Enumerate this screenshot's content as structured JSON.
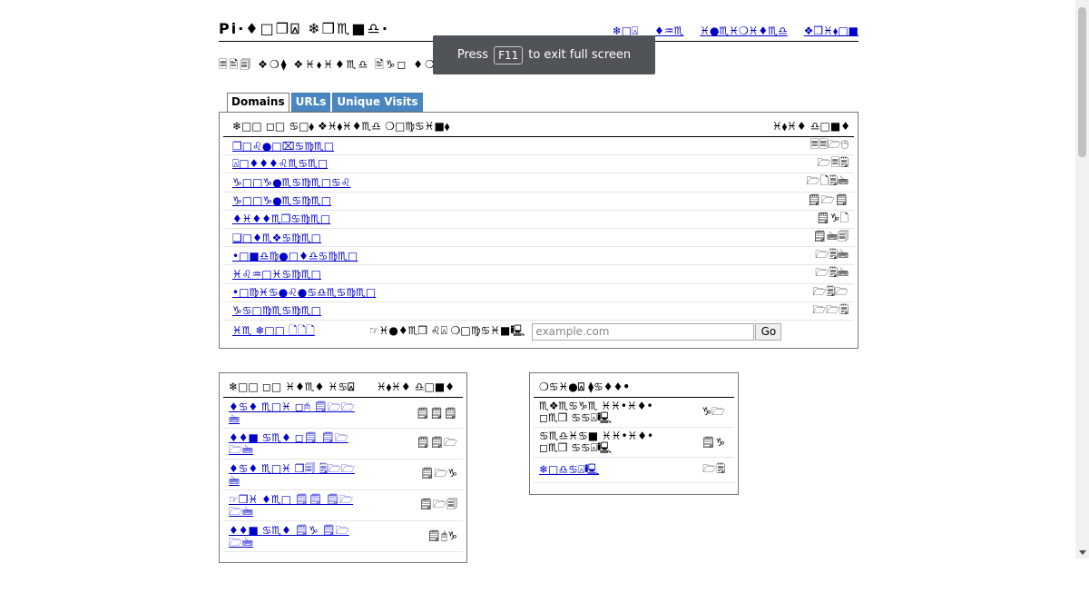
{
  "site": {
    "title": "Pi·♦□❒⍓ ❄❒♏■♎·",
    "nav": [
      "❄□⍓",
      "♦♒♏",
      "♓●♏♓❍♓♦♏♎",
      "❖❒♓⬧□■"
    ],
    "subtitle": "🗏🖹🗐 ❖❍⧫ ❖♓⬧♓♦♏♎ 🖹♑◻ ♦❍□⧫"
  },
  "tabs": [
    "Domains",
    "URLs",
    "Unique Visits"
  ],
  "domains": {
    "header_left": "❄□□ ◻□ ♋□⬧ ❖♓⬧♓♦♏♎ ❍□♍♋♓■⬧",
    "header_right": "♓⬧♓♦ ♎□■♦",
    "rows": [
      {
        "name": "❒□♌●□⌧♋♍♏□",
        "count": "🗏🗏🗁🖰"
      },
      {
        "name": "⍓□♦♦♦♌♏♋♏□",
        "count": "🗁🗏🗒"
      },
      {
        "name": "♑□□♑●♏♋♍♏□♋♌",
        "count": "🗁🗋🗒🖮"
      },
      {
        "name": "♑□□♑●♏♋♍♏□",
        "count": "🗒🗁🗒"
      },
      {
        "name": "♦♓♦♦♏❒♋♍♏□",
        "count": "🗒♑🗋"
      },
      {
        "name": "❑□♦♏❖♋♍♏□",
        "count": "🗒🖮🗐"
      },
      {
        "name": "•□■♎♍●□♦♎♋♍♏□",
        "count": "🗁🗒🖮"
      },
      {
        "name": "♓♌♒□♓♋♍♏□",
        "count": "🗁🗒🖮"
      },
      {
        "name": "•□♍♓♋●♌●♋♎♏♋♍♏□",
        "count": "🗁🗒🗁"
      },
      {
        "name": "♑♋□♍♏♋♍♏□",
        "count": "🗁🗁🗒"
      }
    ],
    "more_link": "♓♏ ❄□□ 🗋🗋🗋",
    "lookup_label": "☞♓●♦♏❒ ♌⍓ ❍□♍♋♓■🖳",
    "input_placeholder": "example.com",
    "go_label": "Go"
  },
  "stats": {
    "header_left": "❄□□ ◻□ ♓♦♏♦ ♓♋⍓",
    "header_right": "♓⬧♓♦ ♎□■♦",
    "rows": [
      {
        "label": "♦♋♦ ♏□♓ ◻🖰 🗒🗁🗁🖮",
        "count": "🗒🗒🗒"
      },
      {
        "label": "♦♦■ ♋♏♦ ◻🗒 🗒🗁🗁🖮",
        "count": "🗒🗒🗁"
      },
      {
        "label": "♦♋♦ ♏□♓ ❒🗐 🗒🗁🗁🖮",
        "count": "🗒🗁♑"
      },
      {
        "label": "☞❒♓ ♦♏□ 🗒🗒 🗒🗁🗁🖮",
        "count": "🗒🗁🗐"
      },
      {
        "label": "♦♦■ ♋♏♦ 🗒♑ 🗒🗁🗁🖮",
        "count": "🗒🖰♑"
      }
    ]
  },
  "totals": {
    "header": "❍♋♓●⍓ ⧫♋♦♦•",
    "rows": [
      {
        "label": "♏❖♏♋♑♏ ♓♓•♓♦• ◻♏❒ ♋♋⍓🖳",
        "count": "♑🗁"
      },
      {
        "label": "♋♏♎♓♋■ ♓♓•♓♦• ◻♏❒ ♋♋⍓🖳",
        "count": "🗒♑"
      },
      {
        "label": "❄□♎♋⍓🖳",
        "count": "🗁🗒"
      }
    ]
  },
  "fullscreen_toast": {
    "prefix": "Press",
    "key": "F11",
    "suffix": "to exit full screen"
  }
}
